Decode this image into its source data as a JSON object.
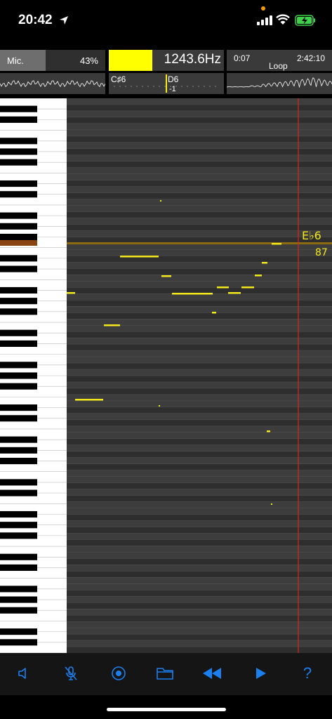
{
  "status": {
    "time": "20:42",
    "icons": [
      "location-arrow-icon",
      "recording-dot-icon",
      "cellular-signal-icon",
      "wifi-icon",
      "battery-charging-icon"
    ]
  },
  "input": {
    "label": "Mic.",
    "level_text": "43%",
    "level": 0.43
  },
  "pitch": {
    "frequency": "1243.6Hz",
    "swatch_color": "#ffff00",
    "lower_note": "C♯6",
    "upper_note": "D6",
    "cents": "-1"
  },
  "playback": {
    "start_time": "0:07",
    "end_time": "2:42:10",
    "loop_label": "Loop"
  },
  "roll": {
    "current_note": "E♭6",
    "current_value": "87",
    "note_color": "#f3e81a",
    "playhead_color": "#e0241f",
    "highlight_key_color": "#8b4513"
  },
  "toolbar": {
    "accent_color": "#1b7ff0",
    "buttons": [
      "speaker-icon",
      "mic-muted-icon",
      "record-icon",
      "folder-icon",
      "rewind-icon",
      "play-icon",
      "help-icon"
    ],
    "help_label": "?"
  }
}
